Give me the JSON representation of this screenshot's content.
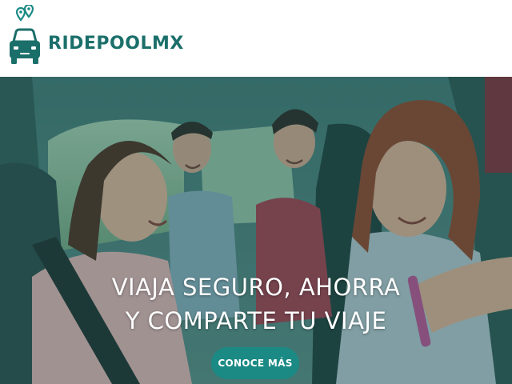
{
  "brand": {
    "name": "RIDEPOOLMX",
    "logo_icon": "car-with-location-pins-icon",
    "color": "#1b6f6a"
  },
  "hero": {
    "image": "people-sharing-car-ride-photo",
    "heading_line_1": "VIAJA SEGURO, AHORRA",
    "heading_line_2": "Y COMPARTE TU VIAJE",
    "cta_label": "CONOCE MÁS",
    "cta_color": "#1b8a84",
    "overlay_color": "#185c5a"
  }
}
